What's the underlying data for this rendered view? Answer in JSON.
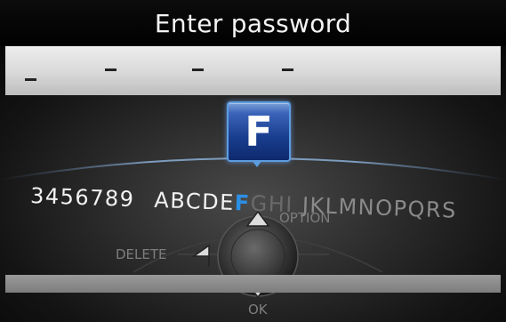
{
  "title": "Enter password",
  "password": {
    "slot_count": 4,
    "filled": 0
  },
  "selector": {
    "selected_char": "F",
    "chars_left": "3456789",
    "chars_before": "ABCDE",
    "chars_selected": "F",
    "chars_after_dim": "GHI",
    "chars_after": "JKLMNOPQRS"
  },
  "controls": {
    "delete_label": "DELETE",
    "option_label": "OPTION",
    "ok_label": "OK"
  },
  "colors": {
    "accent": "#2c8fe6",
    "highlight_box": "#193d8e",
    "password_bar": "#d8d8d8"
  }
}
